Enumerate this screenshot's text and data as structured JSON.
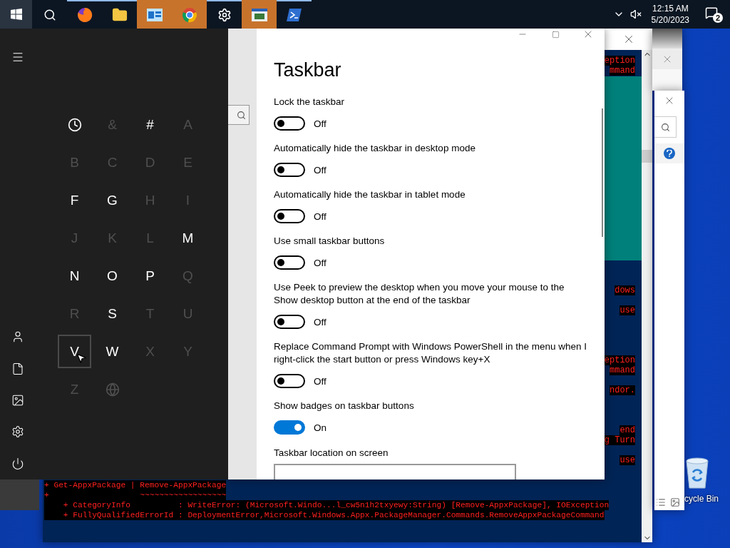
{
  "taskbar": {
    "start_button": {
      "selected": true
    },
    "apps": [
      {
        "running": false,
        "flashing": false
      },
      {
        "running": true,
        "flashing": false
      },
      {
        "running": true,
        "flashing": false
      },
      {
        "running": true,
        "flashing": true
      },
      {
        "running": true,
        "flashing": true
      },
      {
        "running": true,
        "flashing": false
      },
      {
        "running": true,
        "flashing": true
      },
      {
        "running": true,
        "flashing": false
      }
    ],
    "tray": {
      "time": "12:15 AM",
      "date": "5/20/2023",
      "notifications": "2"
    }
  },
  "start_menu": {
    "tiles": [
      {
        "kind": "recent",
        "enabled": true,
        "selected": false
      },
      {
        "kind": "letter",
        "label": "&",
        "enabled": false,
        "selected": false
      },
      {
        "kind": "letter",
        "label": "#",
        "enabled": true,
        "selected": false
      },
      {
        "kind": "letter",
        "label": "A",
        "enabled": false,
        "selected": false
      },
      {
        "kind": "letter",
        "label": "B",
        "enabled": false,
        "selected": false
      },
      {
        "kind": "letter",
        "label": "C",
        "enabled": false,
        "selected": false
      },
      {
        "kind": "letter",
        "label": "D",
        "enabled": false,
        "selected": false
      },
      {
        "kind": "letter",
        "label": "E",
        "enabled": false,
        "selected": false
      },
      {
        "kind": "letter",
        "label": "F",
        "enabled": true,
        "selected": false
      },
      {
        "kind": "letter",
        "label": "G",
        "enabled": true,
        "selected": false
      },
      {
        "kind": "letter",
        "label": "H",
        "enabled": false,
        "selected": false
      },
      {
        "kind": "letter",
        "label": "I",
        "enabled": false,
        "selected": false
      },
      {
        "kind": "letter",
        "label": "J",
        "enabled": false,
        "selected": false
      },
      {
        "kind": "letter",
        "label": "K",
        "enabled": false,
        "selected": false
      },
      {
        "kind": "letter",
        "label": "L",
        "enabled": false,
        "selected": false
      },
      {
        "kind": "letter",
        "label": "M",
        "enabled": true,
        "selected": false
      },
      {
        "kind": "letter",
        "label": "N",
        "enabled": true,
        "selected": false
      },
      {
        "kind": "letter",
        "label": "O",
        "enabled": true,
        "selected": false
      },
      {
        "kind": "letter",
        "label": "P",
        "enabled": true,
        "selected": false
      },
      {
        "kind": "letter",
        "label": "Q",
        "enabled": false,
        "selected": false
      },
      {
        "kind": "letter",
        "label": "R",
        "enabled": false,
        "selected": false
      },
      {
        "kind": "letter",
        "label": "S",
        "enabled": true,
        "selected": false
      },
      {
        "kind": "letter",
        "label": "T",
        "enabled": false,
        "selected": false
      },
      {
        "kind": "letter",
        "label": "U",
        "enabled": false,
        "selected": false
      },
      {
        "kind": "letter",
        "label": "V",
        "enabled": true,
        "selected": true
      },
      {
        "kind": "letter",
        "label": "W",
        "enabled": true,
        "selected": false
      },
      {
        "kind": "letter",
        "label": "X",
        "enabled": false,
        "selected": false
      },
      {
        "kind": "letter",
        "label": "Y",
        "enabled": false,
        "selected": false
      },
      {
        "kind": "letter",
        "label": "Z",
        "enabled": false,
        "selected": false
      },
      {
        "kind": "globe",
        "enabled": false,
        "selected": false
      }
    ]
  },
  "settings": {
    "title": "Taskbar",
    "options": [
      {
        "label": "Lock the taskbar",
        "on": false,
        "state": "Off"
      },
      {
        "label": "Automatically hide the taskbar in desktop mode",
        "on": false,
        "state": "Off"
      },
      {
        "label": "Automatically hide the taskbar in tablet mode",
        "on": false,
        "state": "Off"
      },
      {
        "label": "Use small taskbar buttons",
        "on": false,
        "state": "Off"
      },
      {
        "label": "Use Peek to preview the desktop when you move your mouse to the Show desktop button at the end of the taskbar",
        "on": false,
        "state": "Off"
      },
      {
        "label": "Replace Command Prompt with Windows PowerShell in the menu when I right-click the start button or press Windows key+X",
        "on": false,
        "state": "Off"
      },
      {
        "label": "Show badges on taskbar buttons",
        "on": true,
        "state": "On"
      }
    ],
    "section": "Taskbar location on screen"
  },
  "console": {
    "fragments": [
      "eption",
      "mmand",
      "dows",
      "use",
      "eption",
      "mmand",
      "ndor.",
      "end",
      "g Turn",
      "use"
    ],
    "lines": [
      "+ Get-AppxPackage | Remove-AppxPackage",
      "+                   ~~~~~~~~~~~~~~~~~~",
      "    + CategoryInfo          : WriteError: (Microsoft.Windo...l_cw5n1h2txyewy:String) [Remove-AppxPackage], IOException",
      "    + FullyQualifiedErrorId : DeploymentError,Microsoft.Windows.Appx.PackageManager.Commands.RemoveAppxPackageCommand"
    ]
  },
  "desktop": {
    "icons": [
      {
        "label": "cycle Bin"
      }
    ]
  }
}
